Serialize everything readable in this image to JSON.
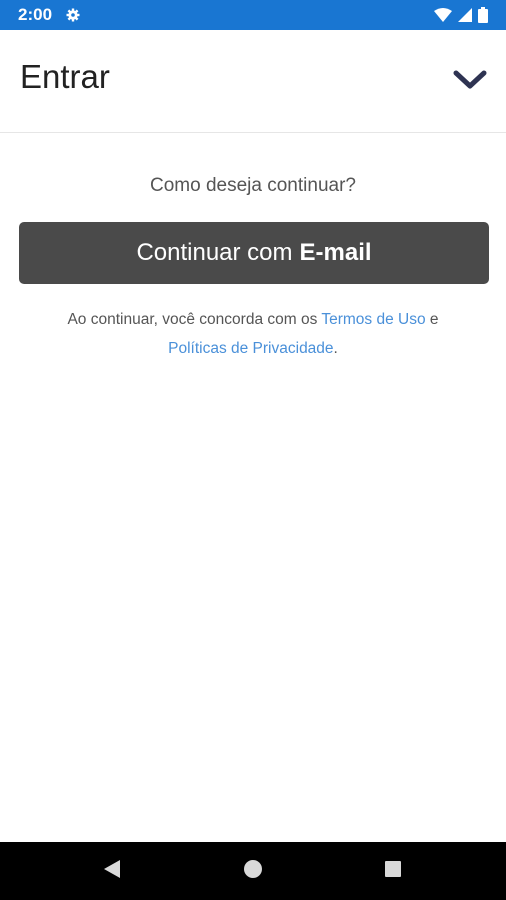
{
  "status_bar": {
    "time": "2:00",
    "icons": [
      "gear-icon",
      "wifi-icon",
      "signal-icon",
      "battery-icon"
    ],
    "background_color": "#1976d2"
  },
  "header": {
    "title": "Entrar",
    "collapse_icon": "chevron-down-icon"
  },
  "main": {
    "prompt": "Como deseja continuar?",
    "email_button": {
      "prefix": "Continuar com",
      "strong": "E-mail",
      "background_color": "#4a4a4a"
    },
    "terms": {
      "text_before": "Ao continuar, você concorda com os ",
      "terms_link": "Termos de Uso",
      "text_middle": " e",
      "privacy_link": "Políticas de Privacidade",
      "text_after": ".",
      "link_color": "#4a90d9"
    }
  },
  "nav_bar": {
    "buttons": [
      "back-icon",
      "home-icon",
      "recents-icon"
    ]
  }
}
